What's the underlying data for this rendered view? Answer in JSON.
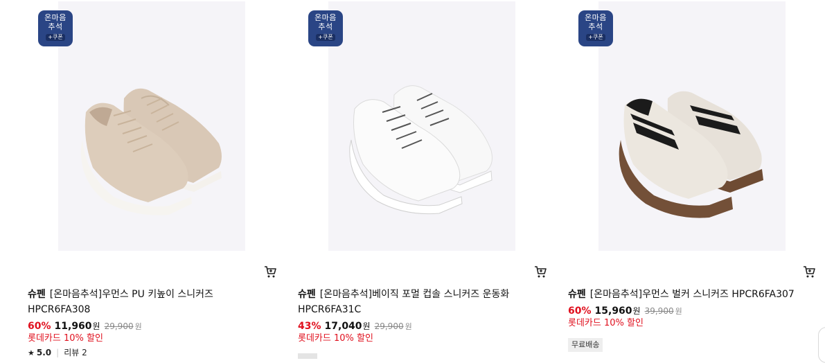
{
  "products": [
    {
      "badge": {
        "line1": "온마음",
        "line2": "추석",
        "coupon": "+쿠폰"
      },
      "brand": "슈펜",
      "name": "[온마음추석]우먼스 PU 키높이 스니커즈 HPCR6FA308",
      "discount_rate": "60%",
      "price": "11,960",
      "currency": "원",
      "original_price": "29,900",
      "original_currency": "원",
      "card_promo": "롯데카드 10% 할인",
      "rating": "5.0",
      "review_label": "리뷰 2",
      "shoe_color": "#d9c8b6"
    },
    {
      "badge": {
        "line1": "온마음",
        "line2": "추석",
        "coupon": "+쿠폰"
      },
      "brand": "슈펜",
      "name": "[온마음추석]베이직 포멀 컵솔 스니커즈 운동화 HPCR6FA31C",
      "discount_rate": "43%",
      "price": "17,040",
      "currency": "원",
      "original_price": "29,900",
      "original_currency": "원",
      "card_promo": "롯데카드 10% 할인",
      "shoe_color": "#f7f7f7"
    },
    {
      "badge": {
        "line1": "온마음",
        "line2": "추석",
        "coupon": "+쿠폰"
      },
      "brand": "슈펜",
      "name": "[온마음추석]우먼스 벌커 스니커즈 HPCR6FA307",
      "discount_rate": "60%",
      "price": "15,960",
      "currency": "원",
      "original_price": "39,900",
      "original_currency": "원",
      "card_promo": "롯데카드 10% 할인",
      "tag": "무료배송",
      "shoe_color": "#e6e0d8"
    }
  ]
}
